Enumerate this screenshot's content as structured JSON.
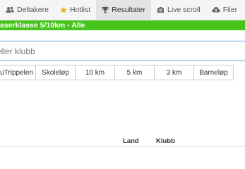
{
  "nav": {
    "items": [
      {
        "label": "Deltakere",
        "icon": "users-icon"
      },
      {
        "label": "Hotlist",
        "icon": "star-icon"
      },
      {
        "label": "Resultater",
        "icon": "trophy-icon"
      },
      {
        "label": "Live scroll",
        "icon": "camera-icon"
      },
      {
        "label": "Filer",
        "icon": "cloud-upload-icon"
      }
    ],
    "active_index": 2
  },
  "class_header": "aserklasse 5/10km - Alle",
  "search": {
    "placeholder": "eller klubb",
    "value": ""
  },
  "tabs": [
    "puTrippelen",
    "Skoleløp",
    "10 km",
    "5 km",
    "3 km",
    "Barneløp"
  ],
  "table": {
    "columns": [
      "Land",
      "Klubb"
    ]
  },
  "colors": {
    "accent": "#46c41b",
    "star": "#f0ad1e",
    "focus_border": "#8cc0ea"
  }
}
